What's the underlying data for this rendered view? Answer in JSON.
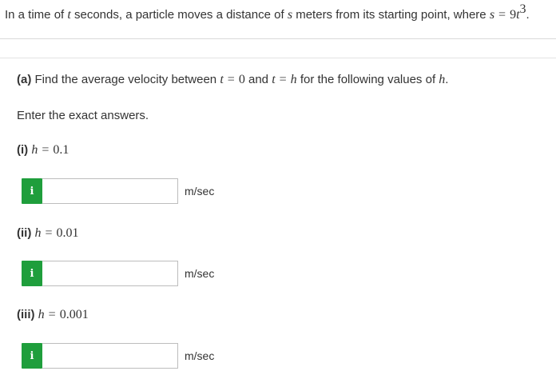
{
  "problem": {
    "text_1": "In a time of",
    "var_t": "t",
    "text_2": "seconds, a particle moves a distance of",
    "var_s": "s",
    "text_3": "meters from its starting point, where",
    "eq_lhs": "s",
    "eq_op": "=",
    "coef": "9",
    "eq_var": "t",
    "exponent": "3",
    "period": "."
  },
  "part_a": {
    "label": "(a)",
    "text_1": "Find the average velocity between",
    "t1_var": "t",
    "t1_op": "=",
    "t1_val": "0",
    "and": "and",
    "t2_var": "t",
    "t2_op": "=",
    "t2_val": "h",
    "text_2": "for the following values of",
    "h_var": "h",
    "period": "."
  },
  "instructions": "Enter the exact answers.",
  "subparts": [
    {
      "label": "(i)",
      "var": "h",
      "op": "=",
      "value": "0.1",
      "answer": "",
      "unit": "m/sec",
      "info_icon": "i"
    },
    {
      "label": "(ii)",
      "var": "h",
      "op": "=",
      "value": "0.01",
      "answer": "",
      "unit": "m/sec",
      "info_icon": "i"
    },
    {
      "label": "(iii)",
      "var": "h",
      "op": "=",
      "value": "0.001",
      "answer": "",
      "unit": "m/sec",
      "info_icon": "i"
    }
  ],
  "colors": {
    "info_button": "#1f9e3c",
    "text": "#333333",
    "input_border": "#bdbdbd"
  }
}
